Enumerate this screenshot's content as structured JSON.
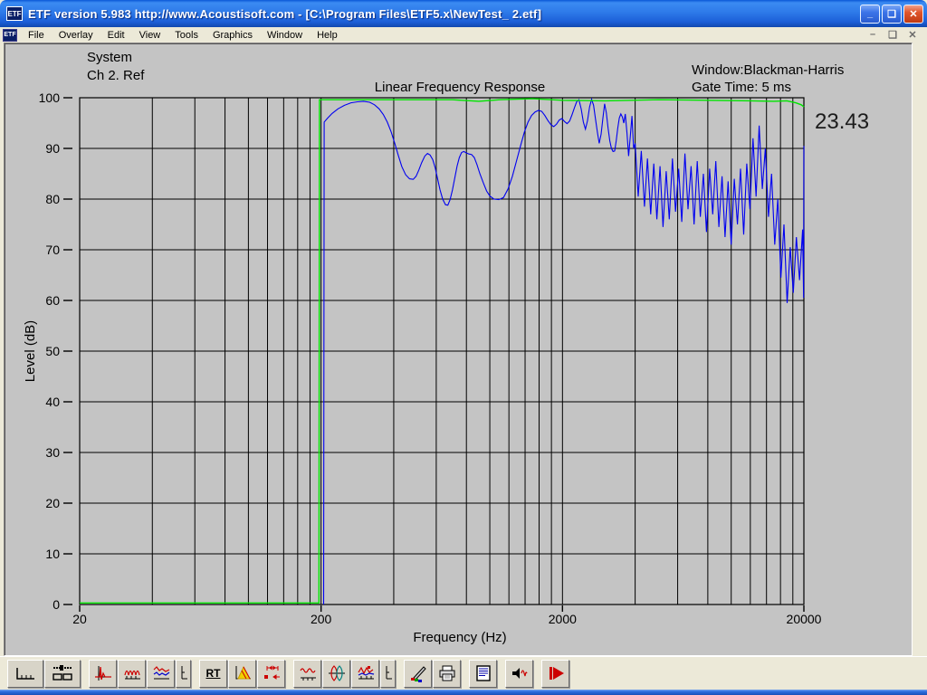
{
  "window": {
    "title": "ETF version 5.983 http://www.Acoustisoft.com - [C:\\Program Files\\ETF5.x\\NewTest_ 2.etf]",
    "icon_text": "ETF",
    "buttons": {
      "minimize": "_",
      "restore": "❏",
      "close": "✕"
    },
    "mdi_buttons": {
      "minimize": "–",
      "restore": "❏",
      "close": "✕"
    }
  },
  "menu": {
    "items": [
      "File",
      "Overlay",
      "Edit",
      "View",
      "Tools",
      "Graphics",
      "Window",
      "Help"
    ]
  },
  "chart": {
    "legend_system": "System",
    "legend_ref": "Ch 2. Ref",
    "info_line1": "Window:Blackman-Harris",
    "info_line2": "Gate Time: 5 ms",
    "title": "Linear Frequency Response",
    "cursor_value": "23.43",
    "xlabel": "Frequency (Hz)",
    "ylabel": "Level (dB)",
    "colors": {
      "system": "#2121d4",
      "reference": "#00e000",
      "grid": "#000000",
      "background": "#c4c4c4"
    }
  },
  "toolbar": {
    "rt_label": "RT",
    "icons": [
      "time-axis-icon",
      "levels-icon",
      "impulse-response-icon",
      "frequency-response-icon",
      "overlay-traces-icon",
      "phase-icon",
      "rt60-label",
      "waterfall-icon",
      "gating-icon",
      "smoothed-response-icon",
      "wavelet-cycles-icon",
      "spectrum-markers-icon",
      "phase-icon-2",
      "color-edit-icon",
      "printer-icon",
      "notes-icon",
      "signal-generator-icon",
      "play-icon"
    ]
  },
  "chart_data": {
    "type": "line",
    "title": "Linear Frequency Response",
    "xlabel": "Frequency (Hz)",
    "ylabel": "Level (dB)",
    "x_scale": "log",
    "xlim": [
      20,
      20000
    ],
    "ylim": [
      0,
      100
    ],
    "grid": true,
    "x_major_ticks": [
      20,
      200,
      2000,
      20000
    ],
    "y_ticks": [
      0,
      10,
      20,
      30,
      40,
      50,
      60,
      70,
      80,
      90,
      100
    ],
    "x_minor_grid": [
      40,
      60,
      80,
      100,
      120,
      140,
      160,
      180,
      200,
      400,
      600,
      800,
      1000,
      1200,
      1400,
      1600,
      1800,
      2000,
      4000,
      6000,
      8000,
      10000,
      12000,
      14000,
      16000,
      18000,
      20000
    ],
    "annotations": {
      "window": "Blackman-Harris",
      "gate_time_ms": 5,
      "cursor_value": 23.43
    },
    "legend_position": "top-left",
    "series": [
      {
        "name": "System",
        "color": "#0000f0",
        "width": 1.1,
        "points": [
          [
            205,
            0
          ],
          [
            206,
            95.2
          ],
          [
            213,
            96.0
          ],
          [
            222,
            96.9
          ],
          [
            235,
            97.8
          ],
          [
            250,
            98.5
          ],
          [
            266,
            99.0
          ],
          [
            283,
            99.2
          ],
          [
            300,
            99.3
          ],
          [
            318,
            99.1
          ],
          [
            333,
            98.6
          ],
          [
            348,
            97.8
          ],
          [
            362,
            96.7
          ],
          [
            376,
            95.2
          ],
          [
            390,
            93.3
          ],
          [
            404,
            91.0
          ],
          [
            418,
            88.6
          ],
          [
            432,
            86.4
          ],
          [
            448,
            84.8
          ],
          [
            465,
            84.0
          ],
          [
            482,
            83.9
          ],
          [
            495,
            84.5
          ],
          [
            508,
            85.7
          ],
          [
            522,
            87.2
          ],
          [
            538,
            88.5
          ],
          [
            552,
            89.0
          ],
          [
            566,
            88.7
          ],
          [
            580,
            87.8
          ],
          [
            594,
            86.2
          ],
          [
            608,
            84.0
          ],
          [
            622,
            81.8
          ],
          [
            638,
            80.0
          ],
          [
            655,
            78.9
          ],
          [
            670,
            78.8
          ],
          [
            685,
            79.9
          ],
          [
            700,
            81.8
          ],
          [
            716,
            84.2
          ],
          [
            732,
            86.5
          ],
          [
            748,
            88.2
          ],
          [
            764,
            89.2
          ],
          [
            780,
            89.4
          ],
          [
            800,
            89.1
          ],
          [
            820,
            88.9
          ],
          [
            840,
            88.8
          ],
          [
            862,
            88.2
          ],
          [
            885,
            86.8
          ],
          [
            910,
            85.0
          ],
          [
            940,
            83.2
          ],
          [
            970,
            81.6
          ],
          [
            1000,
            80.6
          ],
          [
            1040,
            80.0
          ],
          [
            1090,
            79.9
          ],
          [
            1140,
            80.3
          ],
          [
            1190,
            82.0
          ],
          [
            1240,
            84.5
          ],
          [
            1290,
            87.5
          ],
          [
            1340,
            90.5
          ],
          [
            1390,
            93.2
          ],
          [
            1440,
            95.2
          ],
          [
            1490,
            96.5
          ],
          [
            1540,
            97.2
          ],
          [
            1590,
            97.5
          ],
          [
            1640,
            97.3
          ],
          [
            1690,
            96.5
          ],
          [
            1740,
            95.5
          ],
          [
            1790,
            94.7
          ],
          [
            1840,
            94.3
          ],
          [
            1890,
            94.8
          ],
          [
            1940,
            95.6
          ],
          [
            1990,
            95.9
          ],
          [
            2040,
            95.3
          ],
          [
            2090,
            94.9
          ],
          [
            2140,
            95.4
          ],
          [
            2190,
            96.6
          ],
          [
            2240,
            98.0
          ],
          [
            2290,
            99.2
          ],
          [
            2340,
            99.6
          ],
          [
            2390,
            97.8
          ],
          [
            2440,
            95.2
          ],
          [
            2490,
            93.8
          ],
          [
            2540,
            95.5
          ],
          [
            2590,
            98.2
          ],
          [
            2640,
            99.7
          ],
          [
            2690,
            98.5
          ],
          [
            2740,
            95.8
          ],
          [
            2790,
            93.2
          ],
          [
            2840,
            91.0
          ],
          [
            2890,
            92.8
          ],
          [
            2940,
            96.0
          ],
          [
            2990,
            98.8
          ],
          [
            3040,
            97.0
          ],
          [
            3090,
            94.0
          ],
          [
            3140,
            91.5
          ],
          [
            3190,
            90.0
          ],
          [
            3240,
            89.4
          ],
          [
            3290,
            89.5
          ],
          [
            3340,
            91.5
          ],
          [
            3390,
            94.0
          ],
          [
            3440,
            96.0
          ],
          [
            3490,
            96.8
          ],
          [
            3540,
            96.2
          ],
          [
            3590,
            95.0
          ],
          [
            3640,
            96.8
          ],
          [
            3700,
            93.0
          ],
          [
            3760,
            88.5
          ],
          [
            3820,
            92.5
          ],
          [
            3880,
            96.4
          ],
          [
            3940,
            90.0
          ],
          [
            4000,
            91.0
          ],
          [
            4120,
            80.5
          ],
          [
            4240,
            89.5
          ],
          [
            4370,
            78.5
          ],
          [
            4500,
            88.0
          ],
          [
            4640,
            77.0
          ],
          [
            4780,
            87.0
          ],
          [
            4920,
            76.0
          ],
          [
            5070,
            86.5
          ],
          [
            5220,
            74.5
          ],
          [
            5380,
            85.5
          ],
          [
            5540,
            76.0
          ],
          [
            5710,
            88.0
          ],
          [
            5880,
            77.5
          ],
          [
            6060,
            86.0
          ],
          [
            6240,
            75.5
          ],
          [
            6430,
            89.0
          ],
          [
            6620,
            78.0
          ],
          [
            6820,
            86.5
          ],
          [
            7020,
            75.0
          ],
          [
            7230,
            87.5
          ],
          [
            7450,
            76.5
          ],
          [
            7670,
            85.0
          ],
          [
            7900,
            73.5
          ],
          [
            8140,
            86.0
          ],
          [
            8380,
            77.0
          ],
          [
            8630,
            87.5
          ],
          [
            8890,
            74.5
          ],
          [
            9160,
            84.5
          ],
          [
            9430,
            72.5
          ],
          [
            9710,
            83.5
          ],
          [
            10000,
            71.0
          ],
          [
            10300,
            84.0
          ],
          [
            10610,
            75.0
          ],
          [
            10930,
            86.0
          ],
          [
            11260,
            73.0
          ],
          [
            11600,
            87.0
          ],
          [
            11950,
            78.0
          ],
          [
            12310,
            92.0
          ],
          [
            12680,
            80.5
          ],
          [
            13060,
            94.5
          ],
          [
            13450,
            82.0
          ],
          [
            13850,
            90.0
          ],
          [
            14270,
            76.5
          ],
          [
            14700,
            85.0
          ],
          [
            15140,
            71.0
          ],
          [
            15590,
            80.0
          ],
          [
            16060,
            64.5
          ],
          [
            16540,
            75.0
          ],
          [
            17040,
            59.5
          ],
          [
            17550,
            70.5
          ],
          [
            18080,
            61.5
          ],
          [
            18620,
            72.5
          ],
          [
            19180,
            64.0
          ],
          [
            19760,
            74.0
          ],
          [
            19950,
            60.5
          ],
          [
            20000,
            90.5
          ]
        ]
      },
      {
        "name": "Ch 2. Ref",
        "color": "#00e400",
        "width": 1.4,
        "points": [
          [
            20,
            0.3
          ],
          [
            196,
            0.3
          ],
          [
            197,
            99.6
          ],
          [
            700,
            99.6
          ],
          [
            900,
            99.3
          ],
          [
            1100,
            99.6
          ],
          [
            1500,
            99.8
          ],
          [
            2000,
            99.5
          ],
          [
            3000,
            99.4
          ],
          [
            5000,
            99.6
          ],
          [
            8000,
            99.5
          ],
          [
            12000,
            99.4
          ],
          [
            15000,
            99.3
          ],
          [
            17000,
            99.4
          ],
          [
            18500,
            99.0
          ],
          [
            19500,
            98.6
          ],
          [
            20000,
            98.2
          ]
        ]
      }
    ]
  }
}
